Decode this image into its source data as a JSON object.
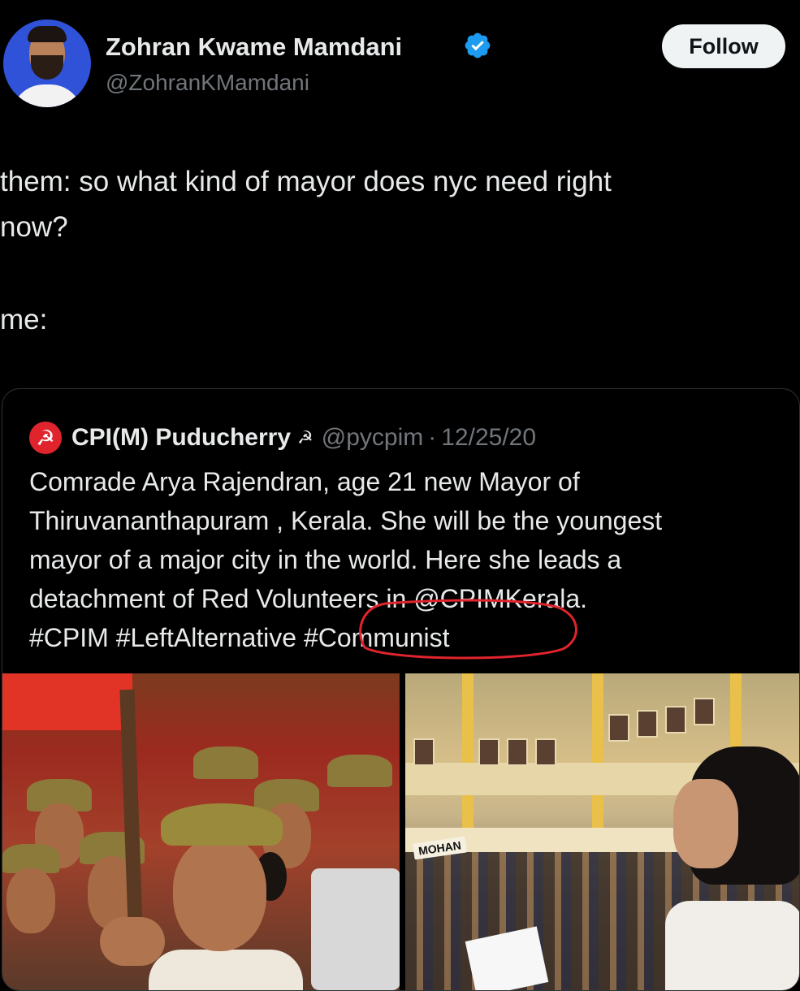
{
  "header": {
    "display_name": "Zohran Kwame Mamdani",
    "handle": "@ZohranKMamdani",
    "follow_label": "Follow",
    "verified_icon": "verified-badge-icon",
    "verified_color": "#1d9bf0"
  },
  "tweet": {
    "line1": "them: so what kind of mayor does nyc need right",
    "line2": "now?",
    "line3": "me:"
  },
  "quote": {
    "author_name": "CPI(M) Puducherry",
    "author_symbol": "☭",
    "name_emoji": "☭",
    "handle": "@pycpim",
    "separator": "·",
    "date": "12/25/20",
    "logo_color": "#e0242d",
    "body_lines": [
      "Comrade Arya Rajendran, age 21  new Mayor of",
      "Thiruvananthapuram , Kerala. She will be the youngest",
      "mayor of a major city in the world. Here she leads a",
      "detachment of Red Volunteers in @CPIMKerala.",
      "#CPIM  #LeftAlternative #Communist"
    ],
    "annotation_color": "#e0242d",
    "image_right_label": "MOHAN"
  }
}
